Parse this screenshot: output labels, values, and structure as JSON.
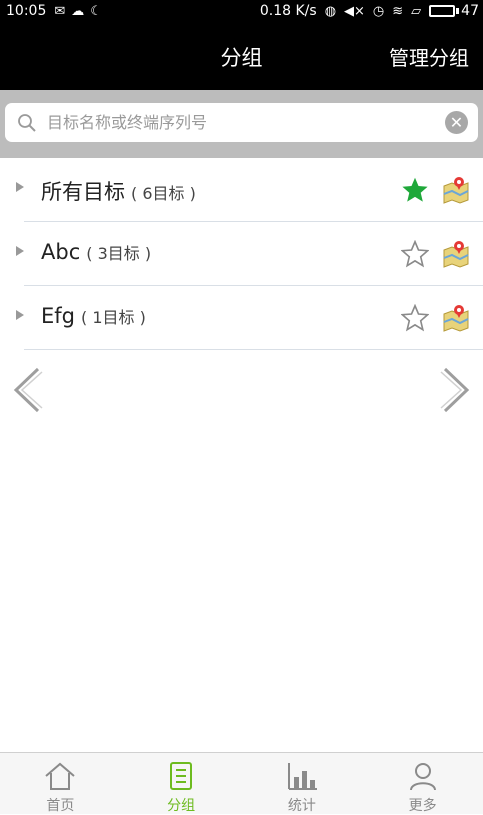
{
  "status_bar": {
    "time": "10:05",
    "net_speed": "0.18 K/s",
    "battery": "47"
  },
  "header": {
    "title": "分组",
    "manage_label": "管理分组"
  },
  "search": {
    "placeholder": "目标名称或终端序列号",
    "value": ""
  },
  "groups": [
    {
      "name": "所有目标",
      "count": "( 6目标 )",
      "starred": true
    },
    {
      "name": "Abc",
      "count": "( 3目标 )",
      "starred": false
    },
    {
      "name": "Efg",
      "count": "( 1目标 )",
      "starred": false
    }
  ],
  "tabs": [
    {
      "label": "首页",
      "icon": "home-icon"
    },
    {
      "label": "分组",
      "icon": "group-icon",
      "active": true
    },
    {
      "label": "统计",
      "icon": "stats-icon"
    },
    {
      "label": "更多",
      "icon": "user-icon"
    }
  ],
  "colors": {
    "accent": "#6dbb1f",
    "star_active": "#1fa83a"
  }
}
